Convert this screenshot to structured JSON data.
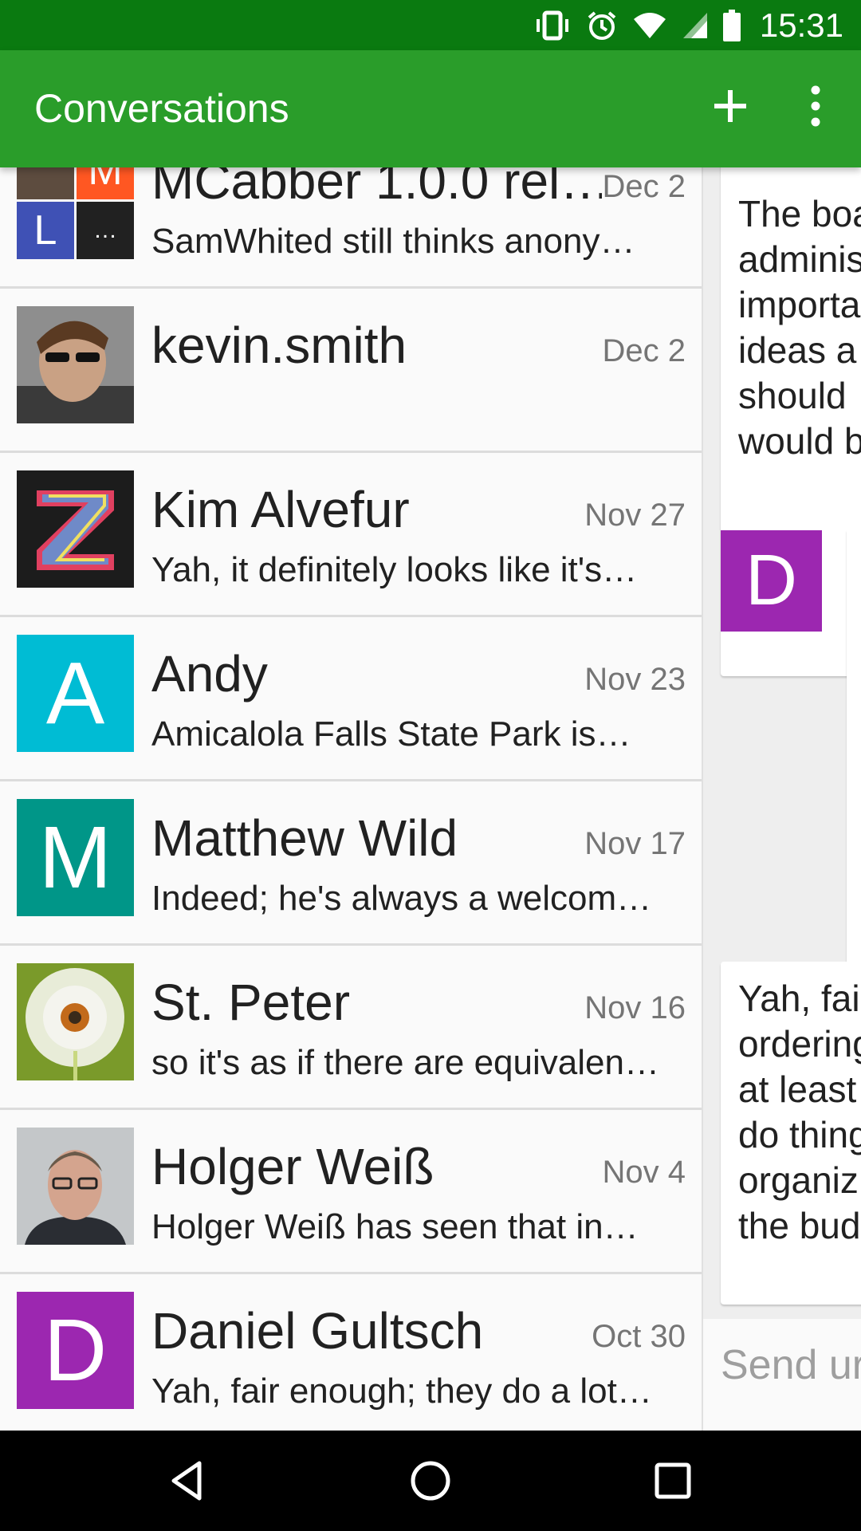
{
  "status_bar": {
    "time": "15:31",
    "icons": [
      "vibrate-icon",
      "alarm-icon",
      "wifi-icon",
      "cellular-signal-icon",
      "battery-icon"
    ]
  },
  "app_bar": {
    "title": "Conversations",
    "actions": [
      "add-icon",
      "overflow-menu-icon"
    ]
  },
  "conversations": [
    {
      "name": "MCabber 1.0.0 rel…",
      "date": "Dec 2",
      "preview": "SamWhited still thinks anony…",
      "avatar": "group-collage"
    },
    {
      "name": "kevin.smith",
      "date": "Dec 2",
      "preview": "",
      "avatar": "photo"
    },
    {
      "name": "Kim Alvefur",
      "date": "Nov 27",
      "preview": "Yah, it definitely looks like it's…",
      "avatar": "photo"
    },
    {
      "name": "Andy",
      "date": "Nov 23",
      "preview": "Amicalola Falls State Park is…",
      "avatar_letter": "A",
      "avatar_color": "#00bcd4"
    },
    {
      "name": "Matthew Wild",
      "date": "Nov 17",
      "preview": "Indeed; he's always a welcom…",
      "avatar_letter": "M",
      "avatar_color": "#009688"
    },
    {
      "name": "St. Peter",
      "date": "Nov 16",
      "preview": "so it's as if there are equivalen…",
      "avatar": "photo"
    },
    {
      "name": "Holger Weiß",
      "date": "Nov 4",
      "preview": "Holger Weiß has seen that in…",
      "avatar": "photo"
    },
    {
      "name": "Daniel Gultsch",
      "date": "Oct 30",
      "preview": "Yah, fair enough; they do a lot…",
      "avatar_letter": "D",
      "avatar_color": "#9c27b0"
    }
  ],
  "group_avatar_letters": {
    "top_right": "M",
    "bottom_left": "L",
    "bottom_right": "…"
  },
  "chat_panel": {
    "message_1_lines": [
      "The boa",
      "adminis",
      "importa",
      "ideas a",
      "should",
      "would b"
    ],
    "sender_avatar_letter": "D",
    "message_2_lines": [
      "Yah, fai",
      "ordering",
      "at least",
      "do thing",
      "organiz",
      "the bud"
    ],
    "compose_placeholder": "Send ur"
  },
  "colors": {
    "status_bar": "#0a7a10",
    "app_bar": "#2a9d2a",
    "andy": "#00bcd4",
    "matthew": "#009688",
    "daniel": "#9c27b0"
  }
}
